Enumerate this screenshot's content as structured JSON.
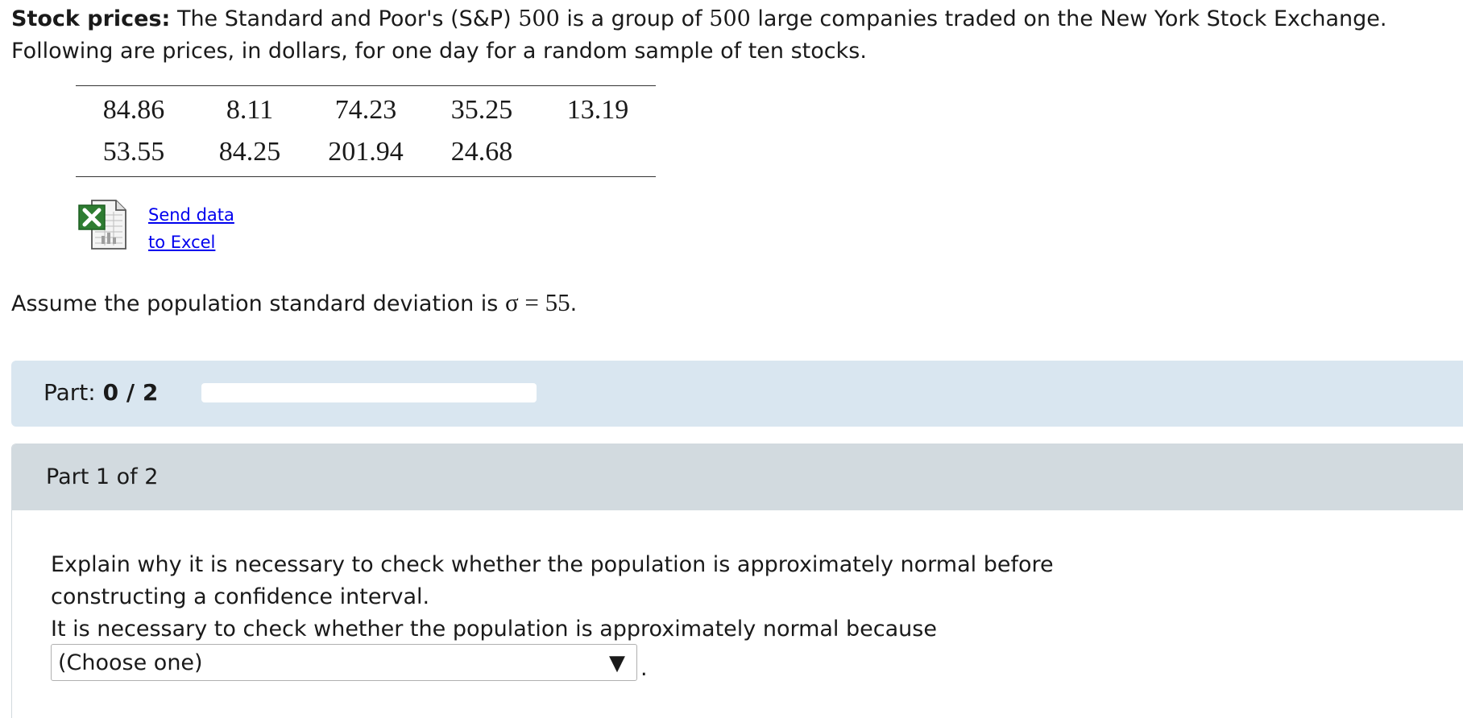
{
  "intro": {
    "bold_label": "Stock prices:",
    "line1_a": "The Standard and Poor's (S&P)",
    "n1": "500",
    "line1_b": "is a group of",
    "n2": "500",
    "line1_c": "large companies traded on the New York Stock Exchange.",
    "line2": "Following are prices, in dollars, for one day for a random sample of ten stocks."
  },
  "table": {
    "rows": [
      [
        "84.86",
        "8.11",
        "74.23",
        "35.25",
        "13.19"
      ],
      [
        "53.55",
        "84.25",
        "201.94",
        "24.68",
        ""
      ]
    ]
  },
  "excel": {
    "line1": "Send data",
    "line2": "to Excel",
    "icon": "excel-icon"
  },
  "assume": {
    "text": "Assume the population standard deviation is",
    "sigma": "σ = 55",
    "end": "."
  },
  "part_bar": {
    "label": "Part:",
    "progress": "0 / 2",
    "fill_fraction": 0
  },
  "part1": {
    "header": "Part 1 of 2",
    "question_line1": "Explain why it is necessary to check whether the population is approximately normal before",
    "question_line2": "constructing a confidence interval.",
    "question_line3": "It is necessary to check whether the population is approximately normal because",
    "dropdown_value": "(Choose one)",
    "dropdown_arrow": "▼",
    "period": "."
  },
  "colors": {
    "part_bar_bg": "#d9e6f0",
    "part_header_bg": "#d2dadf",
    "link": "#0000ee"
  }
}
